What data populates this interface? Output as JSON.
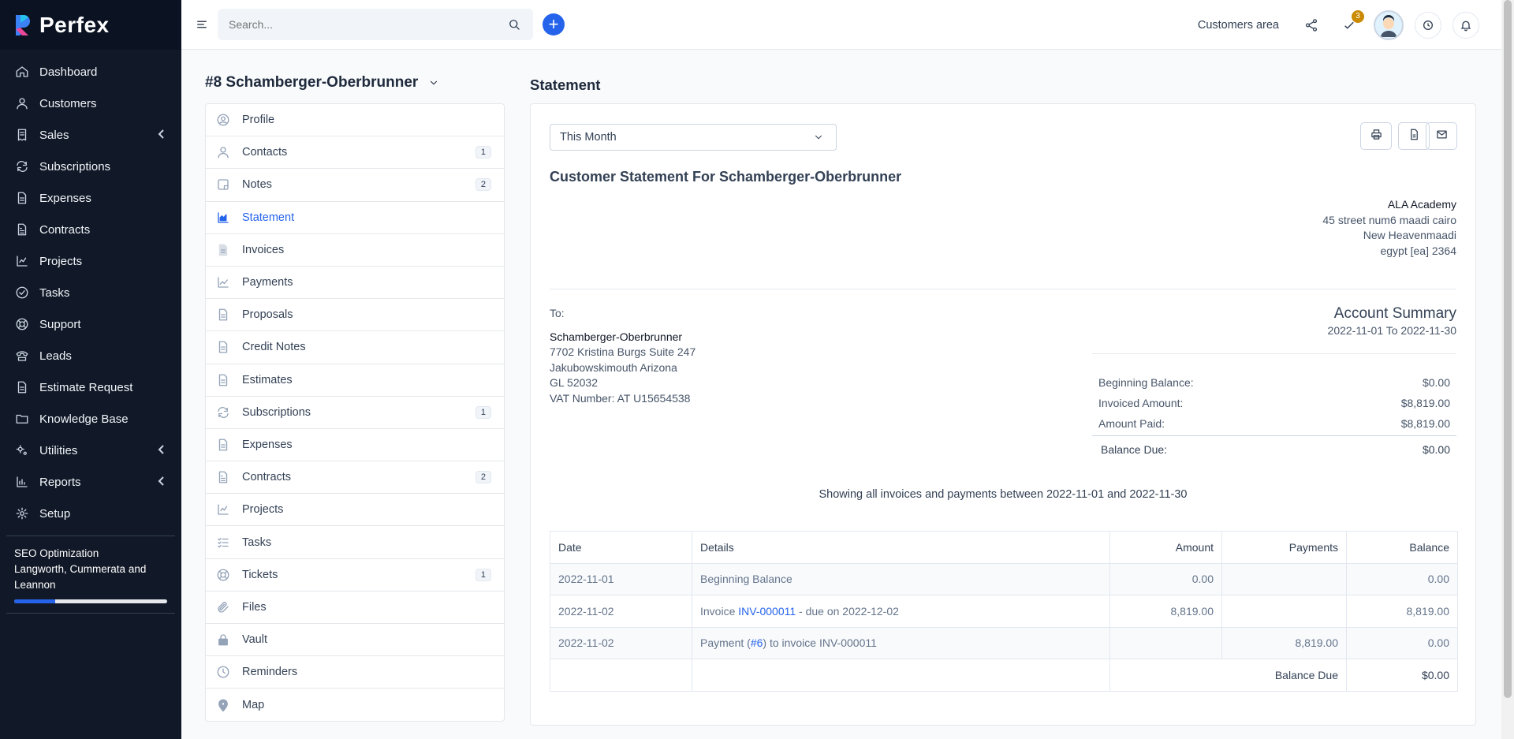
{
  "brand": {
    "name": "Perfex"
  },
  "sidebar": {
    "items": [
      {
        "label": "Dashboard",
        "icon": "home-icon"
      },
      {
        "label": "Customers",
        "icon": "user-icon"
      },
      {
        "label": "Sales",
        "icon": "receipt-icon",
        "submenu": true
      },
      {
        "label": "Subscriptions",
        "icon": "repeat-icon"
      },
      {
        "label": "Expenses",
        "icon": "file-icon"
      },
      {
        "label": "Contracts",
        "icon": "contract-icon"
      },
      {
        "label": "Projects",
        "icon": "chart-icon"
      },
      {
        "label": "Tasks",
        "icon": "check-circle-icon"
      },
      {
        "label": "Support",
        "icon": "lifebuoy-icon"
      },
      {
        "label": "Leads",
        "icon": "tty-icon"
      },
      {
        "label": "Estimate Request",
        "icon": "file-icon"
      },
      {
        "label": "Knowledge Base",
        "icon": "folder-icon"
      },
      {
        "label": "Utilities",
        "icon": "cogs-icon",
        "submenu": true
      },
      {
        "label": "Reports",
        "icon": "bar-chart-icon",
        "submenu": true
      },
      {
        "label": "Setup",
        "icon": "gear-icon"
      }
    ],
    "project": {
      "name": "SEO Optimization",
      "client": "Langworth, Cummerata and Leannon",
      "progress": 0.27
    }
  },
  "header": {
    "search_placeholder": "Search...",
    "customers_area": "Customers area",
    "todo_count": "3"
  },
  "customer": {
    "title": "#8 Schamberger-Oberbrunner",
    "menu": [
      {
        "label": "Profile",
        "icon": "user-circle-icon",
        "badge": ""
      },
      {
        "label": "Contacts",
        "icon": "user-icon",
        "badge": "1"
      },
      {
        "label": "Notes",
        "icon": "note-icon",
        "badge": "2"
      },
      {
        "label": "Statement",
        "icon": "area-chart-icon",
        "badge": "",
        "active": true
      },
      {
        "label": "Invoices",
        "icon": "invoice-icon",
        "badge": ""
      },
      {
        "label": "Payments",
        "icon": "line-chart-icon",
        "badge": ""
      },
      {
        "label": "Proposals",
        "icon": "file-icon",
        "badge": ""
      },
      {
        "label": "Credit Notes",
        "icon": "file-icon",
        "badge": ""
      },
      {
        "label": "Estimates",
        "icon": "file-icon",
        "badge": ""
      },
      {
        "label": "Subscriptions",
        "icon": "repeat-icon",
        "badge": "1"
      },
      {
        "label": "Expenses",
        "icon": "file-icon",
        "badge": ""
      },
      {
        "label": "Contracts",
        "icon": "contract-icon",
        "badge": "2"
      },
      {
        "label": "Projects",
        "icon": "chart-icon",
        "badge": ""
      },
      {
        "label": "Tasks",
        "icon": "tasks-icon",
        "badge": ""
      },
      {
        "label": "Tickets",
        "icon": "lifebuoy-icon",
        "badge": "1"
      },
      {
        "label": "Files",
        "icon": "paperclip-icon",
        "badge": ""
      },
      {
        "label": "Vault",
        "icon": "lock-icon",
        "badge": ""
      },
      {
        "label": "Reminders",
        "icon": "clock-icon",
        "badge": ""
      },
      {
        "label": "Map",
        "icon": "map-pin-icon",
        "badge": ""
      }
    ]
  },
  "statement": {
    "page_title": "Statement",
    "period": "This Month",
    "heading": "Customer Statement For Schamberger-Oberbrunner",
    "company": [
      "ALA Academy",
      "45 street num6 maadi cairo",
      "New Heavenmaadi",
      "egypt [ea] 2364"
    ],
    "to_label": "To:",
    "to_lines": [
      "Schamberger-Oberbrunner",
      "7702 Kristina Burgs Suite 247",
      "Jakubowskimouth Arizona",
      "GL 52032",
      "VAT Number: AT U15654538"
    ],
    "account_summary": {
      "title": "Account Summary",
      "range": "2022-11-01 To 2022-11-30",
      "rows": [
        {
          "label": "Beginning Balance:",
          "value": "$0.00"
        },
        {
          "label": "Invoiced Amount:",
          "value": "$8,819.00"
        },
        {
          "label": "Amount Paid:",
          "value": "$8,819.00"
        }
      ],
      "due_label": "Balance Due:",
      "due_value": "$0.00"
    },
    "showing": "Showing all invoices and payments between 2022-11-01 and 2022-11-30",
    "table": {
      "headers": [
        "Date",
        "Details",
        "Amount",
        "Payments",
        "Balance"
      ],
      "rows": [
        {
          "date": "2022-11-01",
          "pre": "Beginning Balance",
          "link": "",
          "post": "",
          "amount": "0.00",
          "payments": "",
          "balance": "0.00"
        },
        {
          "date": "2022-11-02",
          "pre": "Invoice ",
          "link": "INV-000011",
          "post": " - due on 2022-12-02",
          "amount": "8,819.00",
          "payments": "",
          "balance": "8,819.00"
        },
        {
          "date": "2022-11-02",
          "pre": "Payment (",
          "link": "#6",
          "post": ") to invoice INV-000011",
          "amount": "",
          "payments": "8,819.00",
          "balance": "0.00"
        }
      ],
      "footer_label": "Balance Due",
      "footer_value": "$0.00"
    }
  }
}
